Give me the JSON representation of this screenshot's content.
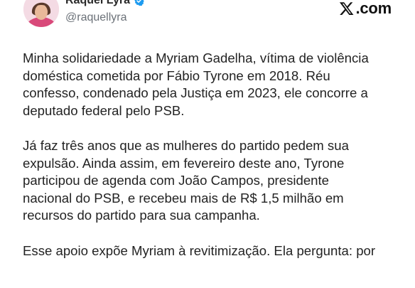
{
  "tweet": {
    "author": {
      "display_name": "Raquel Lyra",
      "handle": "@raquellyra",
      "verified": true,
      "verified_color": "#1d9bf0"
    },
    "brand": {
      "logo_text": ".com",
      "logo_icon": "x-logo-icon"
    },
    "paragraphs": [
      "Minha solidariedade a Myriam Gadelha, vítima de violência\ndoméstica cometida por Fábio Tyrone em 2018. Réu\nconfesso, condenado pela Justiça em 2023, ele concorre a\ndeputado federal pelo PSB.",
      "Já faz três anos que as mulheres do partido pedem sua\nexpulsão. Ainda assim, em fevereiro deste ano, Tyrone\nparticipou de agenda com João Campos, presidente\nnacional do PSB, e recebeu mais de R$ 1,5 milhão em\nrecursos do partido para sua campanha.",
      "Esse apoio expõe Myriam à revitimização. Ela pergunta: por"
    ]
  }
}
